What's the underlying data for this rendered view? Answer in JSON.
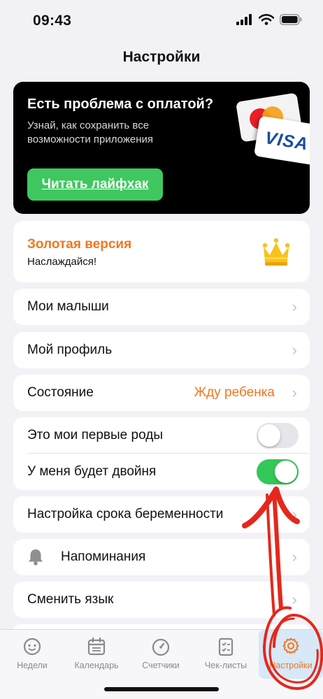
{
  "status_bar": {
    "time": "09:43"
  },
  "header": {
    "title": "Настройки"
  },
  "promo": {
    "title": "Есть проблема с оплатой?",
    "subtitle": "Узнай, как сохранить все возможности приложения",
    "button_label": "Читать лайфхак",
    "card_brand": "VISA"
  },
  "gold": {
    "title": "Золотая версия",
    "subtitle": "Наслаждайся!",
    "icon": "crown-icon"
  },
  "menu": {
    "my_babies": "Мои малыши",
    "my_profile": "Мой профиль",
    "state_label": "Состояние",
    "state_value": "Жду ребенка",
    "first_birth_label": "Это мои первые роды",
    "first_birth_on": false,
    "twins_label": "У меня будет двойня",
    "twins_on": true,
    "pregnancy_term": "Настройка срока беременности",
    "reminders": "Напоминания",
    "change_language": "Сменить язык"
  },
  "tabbar": {
    "items": [
      {
        "label": "Недели",
        "icon": "baby-face-icon",
        "active": false
      },
      {
        "label": "Календарь",
        "icon": "calendar-icon",
        "active": false
      },
      {
        "label": "Счетчики",
        "icon": "stopwatch-icon",
        "active": false
      },
      {
        "label": "Чек-листы",
        "icon": "checklist-icon",
        "active": false
      },
      {
        "label": "Настройки",
        "icon": "gear-icon",
        "active": true
      }
    ]
  },
  "colors": {
    "accent": "#f2761f",
    "green": "#34c759",
    "promo_button": "#3ec85f",
    "annotation": "#e5271b"
  }
}
